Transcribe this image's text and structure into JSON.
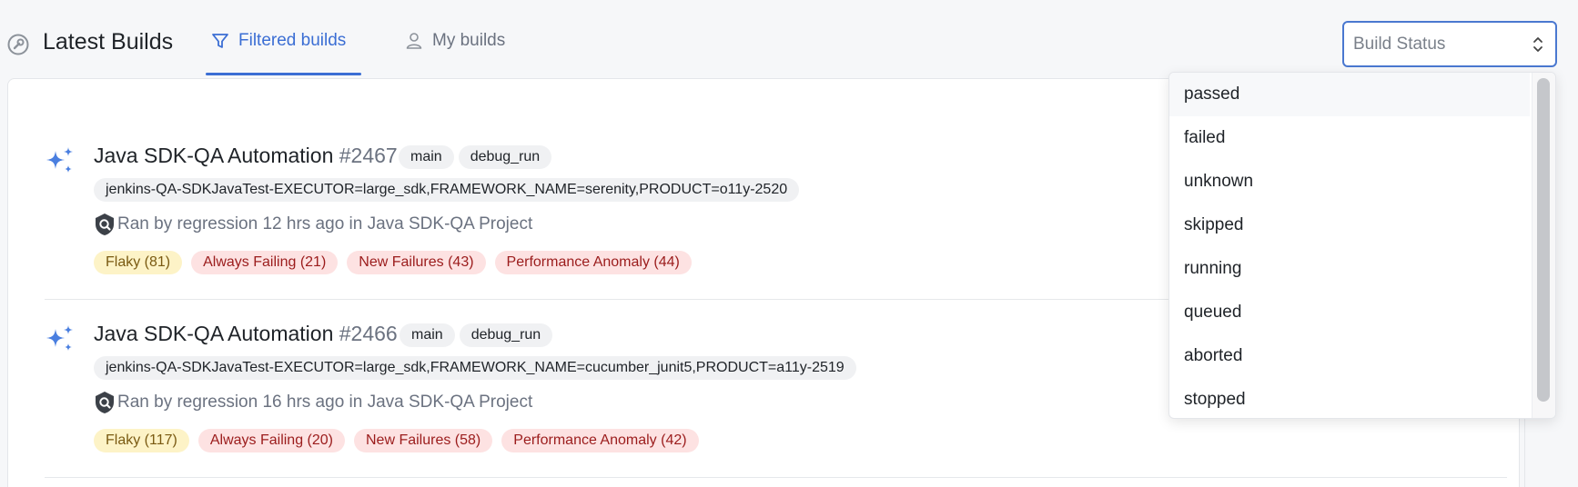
{
  "header": {
    "title": "Latest Builds",
    "tabs": [
      {
        "label": "Filtered builds",
        "active": true
      },
      {
        "label": "My builds",
        "active": false
      }
    ],
    "status_select": {
      "placeholder": "Build Status"
    }
  },
  "builds": [
    {
      "name": "Java SDK-QA Automation",
      "number": "#2467",
      "branches": [
        "main",
        "debug_run"
      ],
      "params": "jenkins-QA-SDKJavaTest-EXECUTOR=large_sdk,FRAMEWORK_NAME=serenity,PRODUCT=o11y-2520",
      "ran_by": "Ran by regression 12 hrs ago in Java SDK-QA Project",
      "tags": {
        "flaky": "Flaky (81)",
        "always_failing": "Always Failing (21)",
        "new_failures": "New Failures (43)",
        "performance_anomaly": "Performance Anomaly (44)"
      }
    },
    {
      "name": "Java SDK-QA Automation",
      "number": "#2466",
      "branches": [
        "main",
        "debug_run"
      ],
      "params": "jenkins-QA-SDKJavaTest-EXECUTOR=large_sdk,FRAMEWORK_NAME=cucumber_junit5,PRODUCT=a11y-2519",
      "ran_by": "Ran by regression 16 hrs ago in Java SDK-QA Project",
      "tags": {
        "flaky": "Flaky (117)",
        "always_failing": "Always Failing (20)",
        "new_failures": "New Failures (58)",
        "performance_anomaly": "Performance Anomaly (42)"
      }
    }
  ],
  "dropdown": {
    "options": [
      "passed",
      "failed",
      "unknown",
      "skipped",
      "running",
      "queued",
      "aborted",
      "stopped"
    ],
    "hovered": "passed"
  },
  "colors": {
    "accent": "#3b6ed4",
    "flaky_bg": "#fdf3c7",
    "failure_bg": "#fde2e2"
  },
  "icons": {
    "app": "wrench-circle-icon",
    "filter": "filter-icon",
    "user": "user-icon",
    "chevron": "chevron-up-down-icon",
    "sparkle": "sparkle-icon",
    "shield": "shield-search-icon"
  }
}
